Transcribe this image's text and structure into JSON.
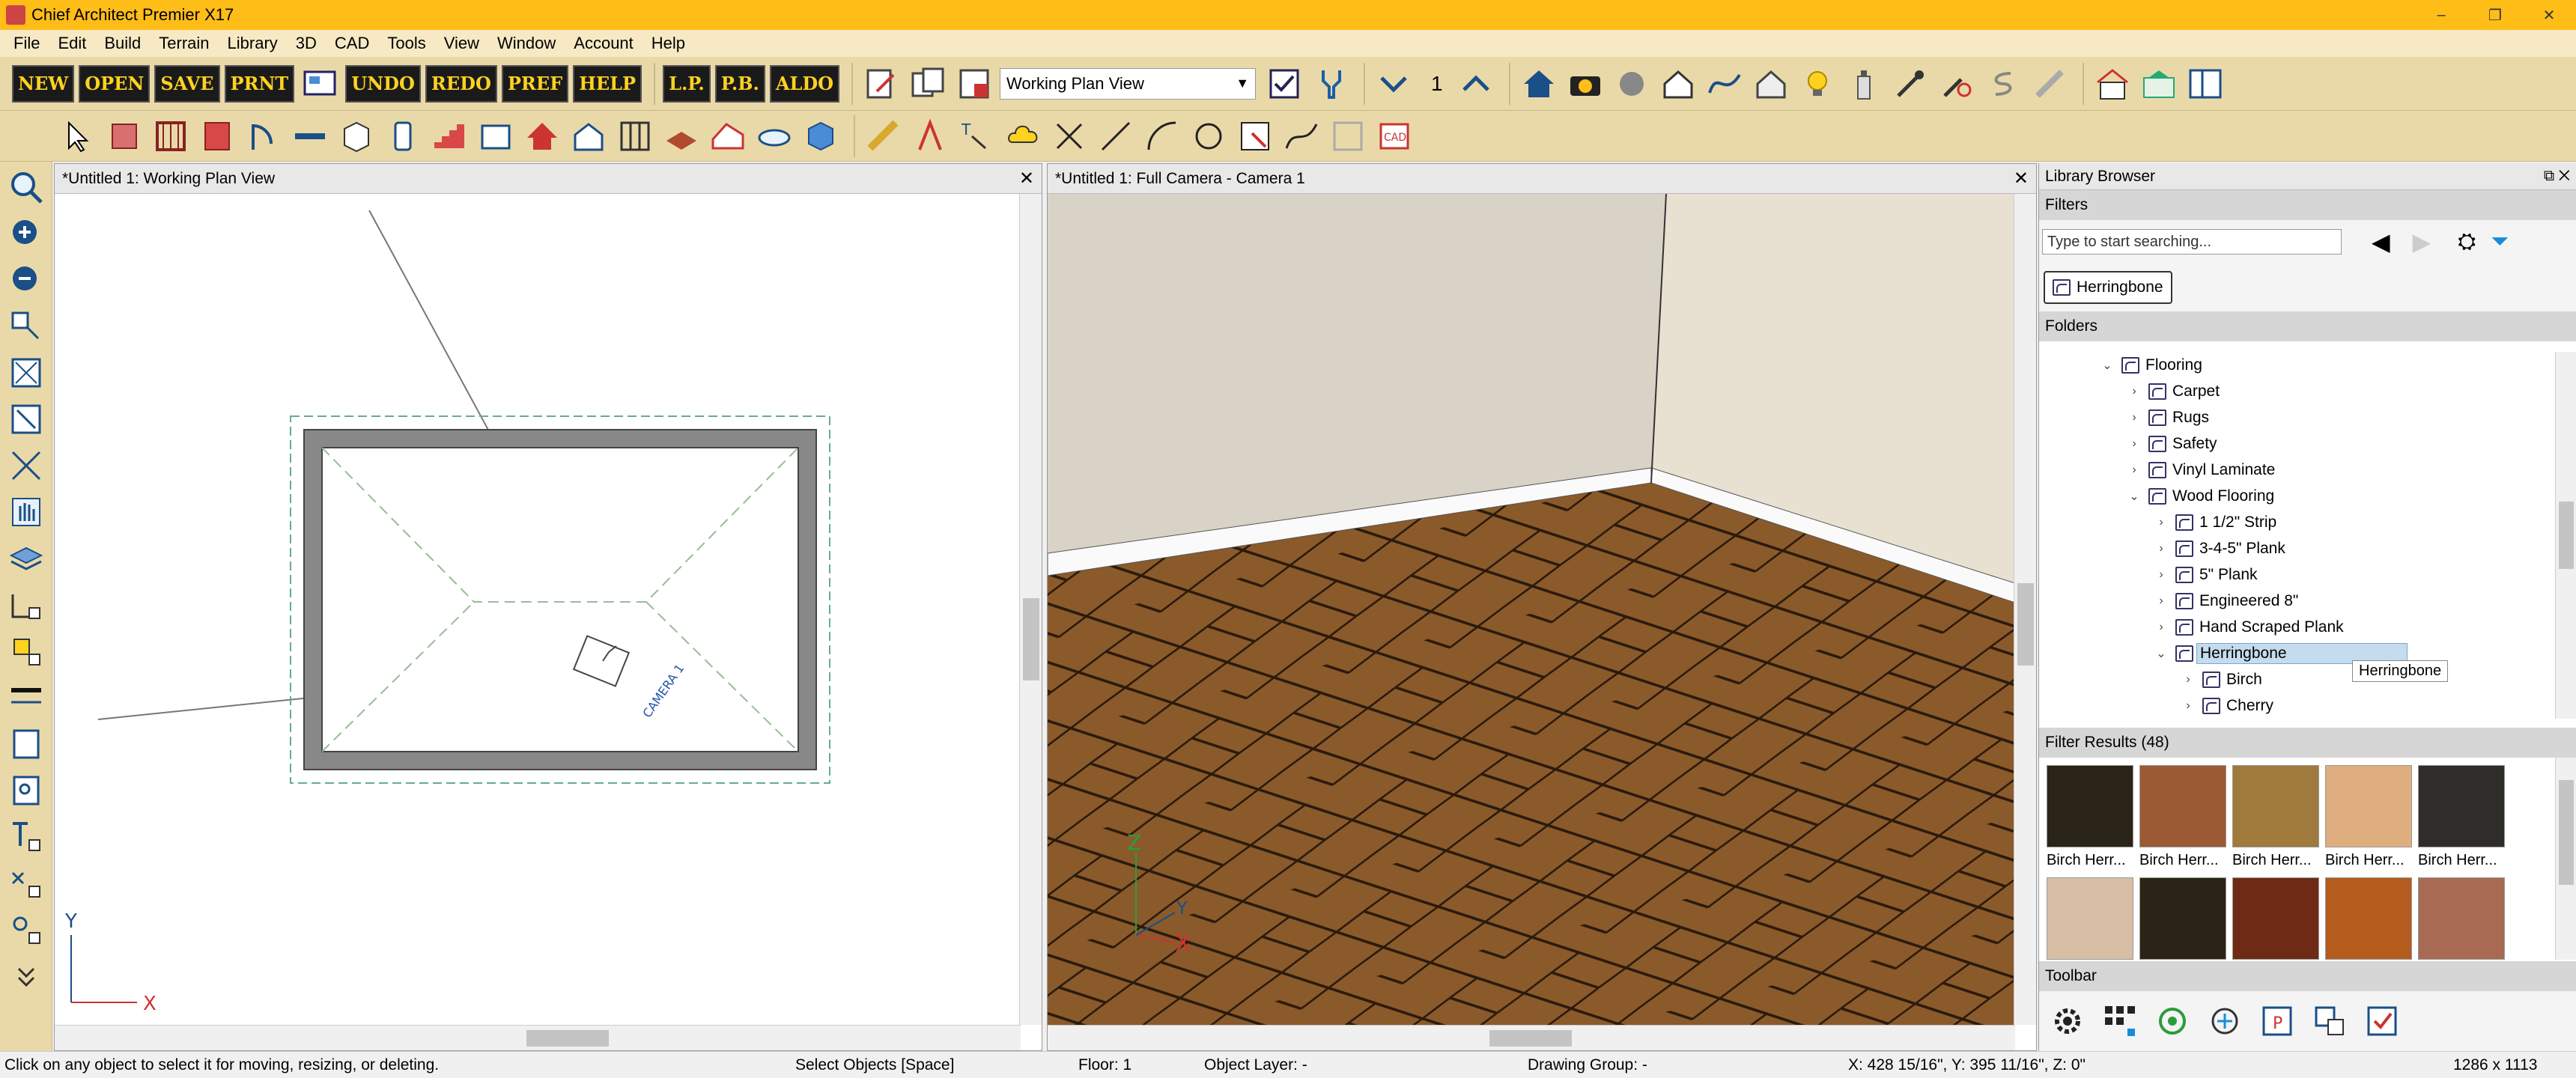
{
  "window": {
    "title": "Chief Architect Premier X17",
    "controls": [
      "–",
      "❐",
      "✕"
    ]
  },
  "menu": [
    "File",
    "Edit",
    "Build",
    "Terrain",
    "Library",
    "3D",
    "CAD",
    "Tools",
    "View",
    "Window",
    "Account",
    "Help"
  ],
  "toolbar": {
    "word_buttons": [
      "NEW",
      "OPEN",
      "SAVE",
      "PRNT",
      "UNDO",
      "REDO",
      "PREF",
      "HELP",
      "L.P.",
      "P.B.",
      "ALDO"
    ],
    "view_select": "Working Plan View",
    "floor_number": "1"
  },
  "plan_view": {
    "title": "*Untitled 1:  Working Plan View",
    "camera_label": "CAMERA 1",
    "axis_x": "X",
    "axis_y": "Y"
  },
  "camera_view": {
    "title": "*Untitled 1: Full Camera - Camera 1",
    "axis_x": "X",
    "axis_y": "Y",
    "axis_z": "Z"
  },
  "library": {
    "title": "Library Browser",
    "filters_heading": "Filters",
    "search_placeholder": "Type to start searching...",
    "filter_chip": "Herringbone",
    "folders_heading": "Folders",
    "tree": [
      {
        "label": "Flooring",
        "level": 0,
        "expander": "⌄"
      },
      {
        "label": "Carpet",
        "level": 1,
        "expander": "›"
      },
      {
        "label": "Rugs",
        "level": 1,
        "expander": "›"
      },
      {
        "label": "Safety",
        "level": 1,
        "expander": "›"
      },
      {
        "label": "Vinyl Laminate",
        "level": 1,
        "expander": "›"
      },
      {
        "label": "Wood Flooring",
        "level": 1,
        "expander": "⌄"
      },
      {
        "label": "1 1/2\" Strip",
        "level": 2,
        "expander": "›"
      },
      {
        "label": "3-4-5\" Plank",
        "level": 2,
        "expander": "›"
      },
      {
        "label": "5\" Plank",
        "level": 2,
        "expander": "›"
      },
      {
        "label": "Engineered 8\"",
        "level": 2,
        "expander": "›"
      },
      {
        "label": "Hand Scraped Plank",
        "level": 2,
        "expander": "›"
      },
      {
        "label": "Herringbone",
        "level": 2,
        "expander": "⌄",
        "selected": true
      },
      {
        "label": "Birch",
        "level": 3,
        "expander": "›"
      },
      {
        "label": "Cherry",
        "level": 3,
        "expander": "›"
      }
    ],
    "tooltip": "Herringbone",
    "results_heading": "Filter Results (48)",
    "results": [
      {
        "label": "Birch Herr...",
        "color": "#2b2418"
      },
      {
        "label": "Birch Herr...",
        "color": "#9c5a34"
      },
      {
        "label": "Birch Herr...",
        "color": "#a07a3c"
      },
      {
        "label": "Birch Herr...",
        "color": "#dfae7e"
      },
      {
        "label": "Birch Herr...",
        "color": "#2e2d2a"
      },
      {
        "label": "",
        "color": "#d8bea4"
      },
      {
        "label": "",
        "color": "#2a2416"
      },
      {
        "label": "",
        "color": "#6e2a14"
      },
      {
        "label": "",
        "color": "#b35c1e"
      },
      {
        "label": "",
        "color": "#a86a52"
      }
    ],
    "toolbar_heading": "Toolbar"
  },
  "status": {
    "hint": "Click on any object to select it for moving, resizing, or deleting.",
    "mode": "Select Objects [Space]",
    "floor": "Floor: 1",
    "layer": "Object Layer: -",
    "group": "Drawing Group: -",
    "coords": "X: 428 15/16\", Y: 395 11/16\", Z: 0\"",
    "size": "1286 x 1113"
  },
  "colors": {
    "titlebar": "#ffbd18",
    "toolbar": "#ead9a8",
    "floor_wood": "#8b5a2b",
    "wall": "#d9d2c6"
  }
}
